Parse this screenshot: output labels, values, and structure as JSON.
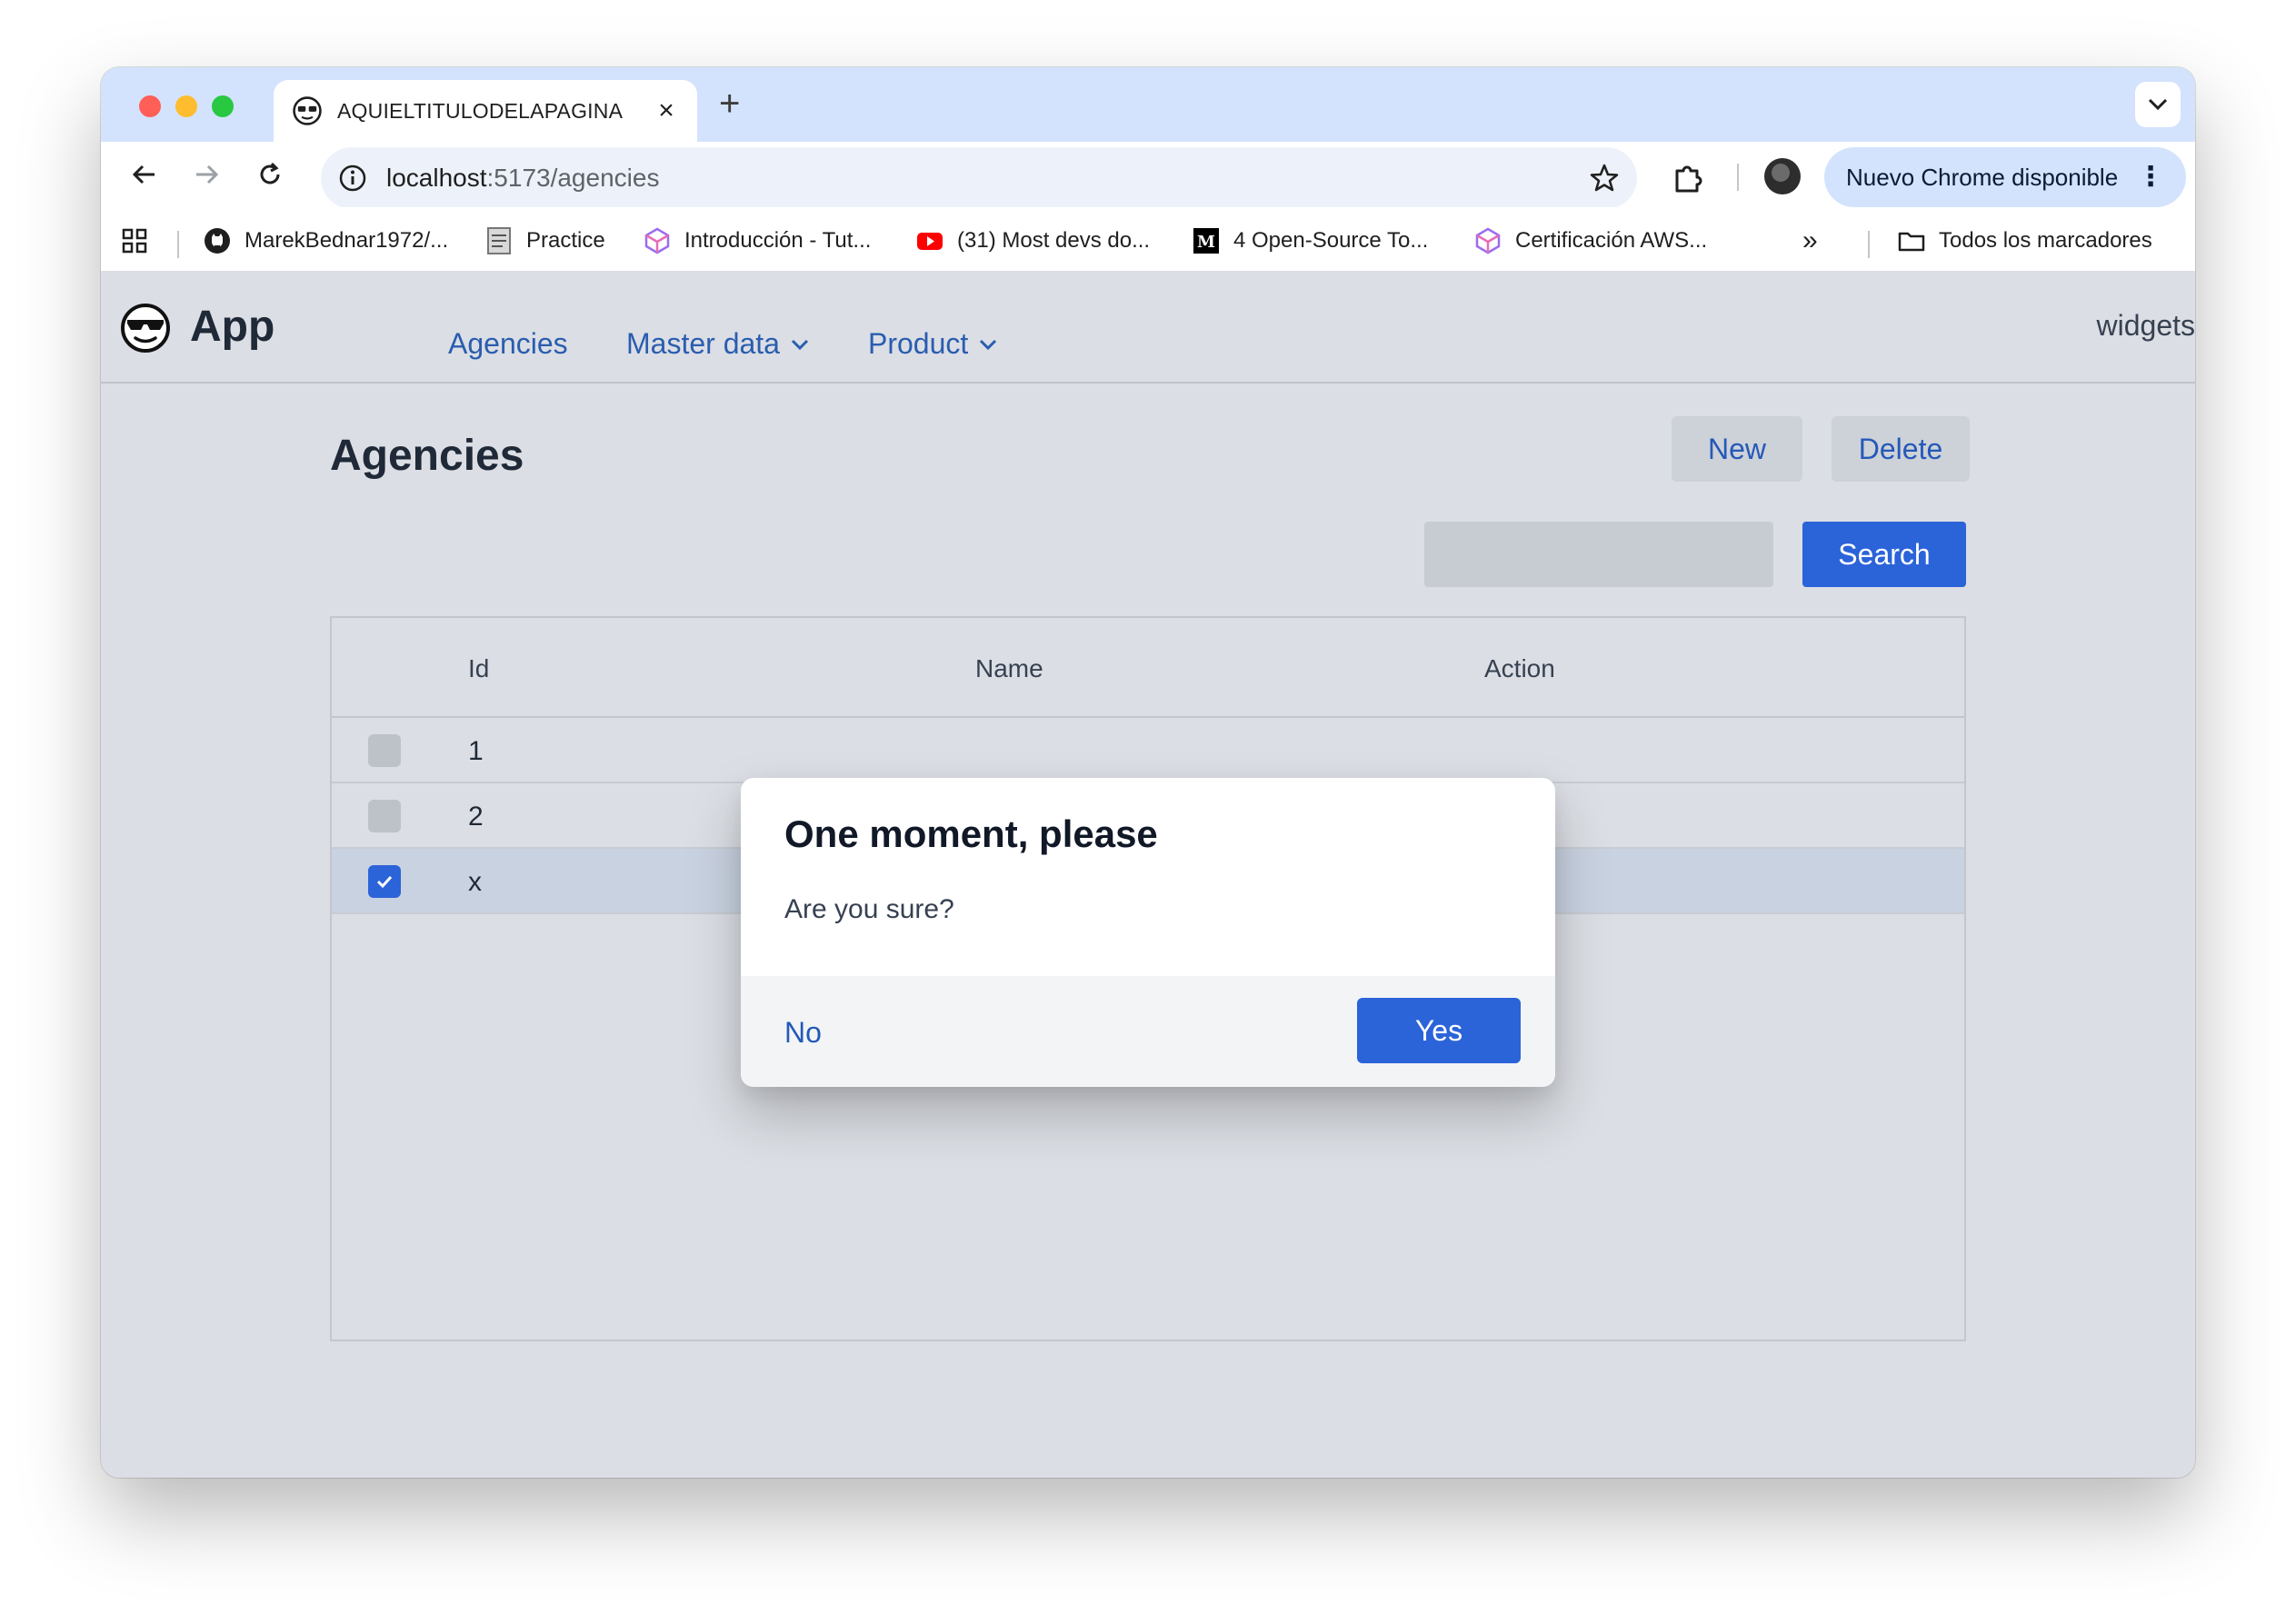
{
  "browser": {
    "tab_title": "AQUIELTITULODELAPAGINA",
    "url_host": "localhost",
    "url_path": ":5173/agencies",
    "update_chip": "Nuevo Chrome disponible",
    "bookmarks": [
      {
        "label": "MarekBednar1972/...",
        "icon": "github-icon"
      },
      {
        "label": "Practice",
        "icon": "practice-icon"
      },
      {
        "label": "Introducción - Tut...",
        "icon": "cube-icon"
      },
      {
        "label": "(31) Most devs do...",
        "icon": "youtube-icon"
      },
      {
        "label": "4 Open-Source To...",
        "icon": "medium-icon"
      },
      {
        "label": "Certificación AWS...",
        "icon": "cube-icon"
      }
    ],
    "all_bookmarks": "Todos los marcadores",
    "more_bookmarks": "»"
  },
  "app": {
    "name": "App",
    "nav": {
      "agencies": "Agencies",
      "master_data": "Master data",
      "product": "Product"
    },
    "widgets": "widgets"
  },
  "page": {
    "title": "Agencies",
    "new_button": "New",
    "delete_button": "Delete",
    "search_button": "Search",
    "search_value": ""
  },
  "table": {
    "columns": [
      "Id",
      "Name",
      "Action"
    ],
    "rows": [
      {
        "id": "1",
        "checked": false
      },
      {
        "id": "2",
        "checked": false
      },
      {
        "id": "x",
        "checked": true
      }
    ]
  },
  "dialog": {
    "title": "One moment, please",
    "message": "Are you sure?",
    "no": "No",
    "yes": "Yes"
  },
  "colors": {
    "primary": "#2b63d9",
    "link": "#2459b8",
    "page_bg": "#dbdee4",
    "selected_row": "#c9d2e1"
  }
}
